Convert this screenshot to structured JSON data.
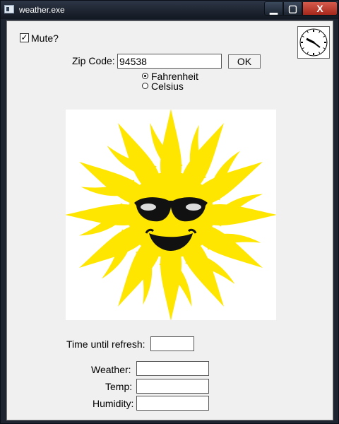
{
  "window": {
    "title": "weather.exe"
  },
  "mute": {
    "label": "Mute?",
    "checked": true,
    "check_glyph": "✓"
  },
  "zip": {
    "label": "Zip Code:",
    "value": "94538"
  },
  "buttons": {
    "ok": "OK",
    "minimize": "▁",
    "maximize": "▢",
    "close": "X"
  },
  "units": {
    "fahrenheit": "Fahrenheit",
    "celsius": "Celsius",
    "selected": "fahrenheit"
  },
  "refresh": {
    "label": "Time until refresh:",
    "value": ""
  },
  "weather": {
    "label": "Weather:",
    "value": ""
  },
  "temp": {
    "label": "Temp:",
    "value": ""
  },
  "humidity": {
    "label": "Humidity:",
    "value": ""
  },
  "icons": {
    "clock": "analog-clock-icon",
    "sun": "sunglasses-sun-illustration"
  },
  "colors": {
    "sun": "#ffe600",
    "sunglasses": "#111111"
  }
}
